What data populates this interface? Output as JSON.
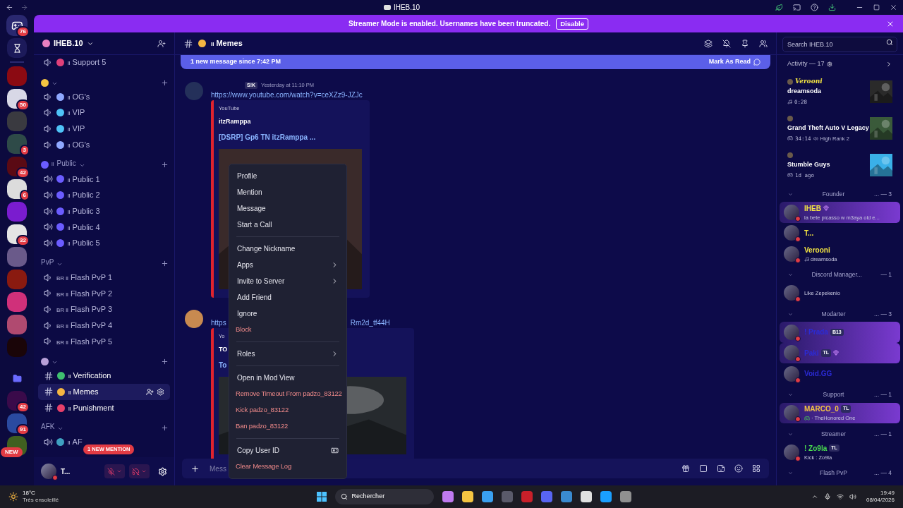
{
  "titlebar": {
    "title": "IHEB.10"
  },
  "banner": {
    "text": "Streamer Mode is enabled. Usernames have been truncated.",
    "button": "Disable"
  },
  "servers": [
    {
      "kind": "home",
      "badge": "76"
    },
    {
      "kind": "hourglass"
    },
    {
      "kind": "server",
      "color": "#8b0a12"
    },
    {
      "kind": "server",
      "color": "#d8d8e6",
      "badge": "50"
    },
    {
      "kind": "server",
      "color": "#3a3a40"
    },
    {
      "kind": "server",
      "color": "#2e4a48",
      "badge": "3"
    },
    {
      "kind": "server",
      "color": "#5a0a14",
      "badge": "42"
    },
    {
      "kind": "server",
      "color": "#dcdcdc",
      "badge": "6"
    },
    {
      "kind": "server",
      "color": "#7a1ccf"
    },
    {
      "kind": "server",
      "color": "#e4e4e4",
      "badge": "32"
    },
    {
      "kind": "server",
      "color": "#6a5a8a"
    },
    {
      "kind": "server",
      "color": "#8a1a10"
    },
    {
      "kind": "server",
      "color": "#d0307a"
    },
    {
      "kind": "server",
      "color": "#b04a70"
    },
    {
      "kind": "server",
      "color": "#1a0508"
    },
    {
      "kind": "folder"
    },
    {
      "kind": "server",
      "color": "#3a0a4a",
      "badge": "42"
    },
    {
      "kind": "server",
      "color": "#2a4aa0",
      "badge": "91"
    },
    {
      "kind": "server",
      "color": "#406020",
      "badge": "NEW"
    }
  ],
  "server_header": {
    "name": "IHEB.10"
  },
  "channels": [
    {
      "kind": "voice-locked",
      "color": "#e0407a",
      "prefix": "ll",
      "name": "Support 5",
      "selected": false
    },
    {
      "kind": "category",
      "color": "#f5c542"
    },
    {
      "kind": "voice-locked",
      "color": "#8fa8ff",
      "prefix": "ll",
      "name": "OG's",
      "selected": false
    },
    {
      "kind": "voice-locked",
      "color": "#4fc3f7",
      "prefix": "ll",
      "name": "VIP",
      "selected": false
    },
    {
      "kind": "voice-locked",
      "color": "#4fc3f7",
      "prefix": "ll",
      "name": "VIP",
      "selected": false
    },
    {
      "kind": "voice-locked",
      "color": "#8fa8ff",
      "prefix": "ll",
      "name": "OG's",
      "selected": false
    },
    {
      "kind": "category",
      "color": "#6b5cff",
      "prefix": "ll",
      "name": "Public"
    },
    {
      "kind": "voice",
      "color": "#6b5cff",
      "prefix": "ll",
      "name": "Public 1",
      "selected": false
    },
    {
      "kind": "voice",
      "color": "#6b5cff",
      "prefix": "ll",
      "name": "Public 2",
      "selected": false
    },
    {
      "kind": "voice",
      "color": "#6b5cff",
      "prefix": "ll",
      "name": "Public 3",
      "selected": false
    },
    {
      "kind": "voice",
      "color": "#6b5cff",
      "prefix": "ll",
      "name": "Public 4",
      "selected": false
    },
    {
      "kind": "voice",
      "color": "#6b5cff",
      "prefix": "ll",
      "name": "Public 5",
      "selected": false
    },
    {
      "kind": "category",
      "name": "PvP"
    },
    {
      "kind": "voice-locked",
      "prefix": "BR ll",
      "name": "Flash PvP 1",
      "selected": false
    },
    {
      "kind": "voice-locked",
      "prefix": "BR ll",
      "name": "Flash PvP 2",
      "selected": false
    },
    {
      "kind": "voice-locked",
      "prefix": "BR ll",
      "name": "Flash PvP 3",
      "selected": false
    },
    {
      "kind": "voice-locked",
      "prefix": "BR ll",
      "name": "Flash PvP 4",
      "selected": false
    },
    {
      "kind": "voice-locked",
      "prefix": "BR ll",
      "name": "Flash PvP 5",
      "selected": false
    },
    {
      "kind": "category",
      "color": "#b8a0d8"
    },
    {
      "kind": "text",
      "color": "#3fbf6f",
      "prefix": "ll",
      "name": "Verification",
      "selected": false
    },
    {
      "kind": "text",
      "color": "#f5b642",
      "prefix": "ll",
      "name": "Memes",
      "selected": true
    },
    {
      "kind": "text",
      "color": "#e8406a",
      "prefix": "ll",
      "name": "Punishment",
      "selected": false
    },
    {
      "kind": "category",
      "name": "AFK"
    },
    {
      "kind": "voice",
      "color": "#3fa0c0",
      "prefix": "ll",
      "name": "AF",
      "selected": false
    }
  ],
  "mention_pill": "1 NEW MENTION",
  "user_panel": {
    "name": "T..."
  },
  "chat_header": {
    "color": "#f5b642",
    "prefix": "ll",
    "name": "Memes"
  },
  "search": {
    "placeholder": "Search IHEB.10"
  },
  "new_messages": {
    "text": "1 new message since 7:42 PM",
    "action": "Mark As Read"
  },
  "messages": [
    {
      "tag": "S!K",
      "time": "Yesterday at 11:10 PM",
      "link": [
        "https://www.youtube.com/watch?v=ceXZz9-JZJc"
      ],
      "embed": {
        "provider": "YouTube",
        "author": "itzRamppa",
        "title": "[DSRP] Gp6 TN itzRamppa ..."
      }
    },
    {
      "link": [
        "https",
        "Rm2d_tf44H"
      ],
      "embed": {
        "provider": "Yo",
        "author": "TO",
        "title": "To"
      }
    }
  ],
  "input": {
    "placeholder": "Mess"
  },
  "context_menu": [
    {
      "kind": "item",
      "label": "Profile"
    },
    {
      "kind": "item",
      "label": "Mention"
    },
    {
      "kind": "item",
      "label": "Message"
    },
    {
      "kind": "item",
      "label": "Start a Call"
    },
    {
      "kind": "divider"
    },
    {
      "kind": "item",
      "label": "Change Nickname"
    },
    {
      "kind": "submenu",
      "label": "Apps"
    },
    {
      "kind": "submenu",
      "label": "Invite to Server"
    },
    {
      "kind": "item",
      "label": "Add Friend"
    },
    {
      "kind": "item",
      "label": "Ignore"
    },
    {
      "kind": "danger",
      "label": "Block"
    },
    {
      "kind": "divider"
    },
    {
      "kind": "submenu",
      "label": "Roles"
    },
    {
      "kind": "divider"
    },
    {
      "kind": "item",
      "label": "Open in Mod View"
    },
    {
      "kind": "danger",
      "label": "Remove Timeout From padzo_83122"
    },
    {
      "kind": "danger",
      "label": "Kick padzo_83122"
    },
    {
      "kind": "danger",
      "label": "Ban padzo_83122"
    },
    {
      "kind": "divider"
    },
    {
      "kind": "copy-id",
      "label": "Copy User ID"
    },
    {
      "kind": "danger",
      "label": "Clear Message Log"
    }
  ],
  "activity": {
    "title": "Activity — 17",
    "cards": [
      {
        "kind": "music",
        "user": "Verooni",
        "title": "dreamsoda",
        "detail": "0:28"
      },
      {
        "kind": "game",
        "title": "Grand Theft Auto V Legacy",
        "detail": "34:14",
        "extra": "High Rank 2"
      },
      {
        "kind": "game",
        "title": "Stumble Guys",
        "detail": "1d ago"
      }
    ]
  },
  "member_groups": [
    {
      "label": "Founder",
      "count": "... — 3",
      "members": [
        {
          "name": "IHEB",
          "color": "#f5e642",
          "booster": true,
          "highlighted": true,
          "status": "la bete picasso w m3aya old e..."
        },
        {
          "name": "T...",
          "color": "#f5e642",
          "booster": false,
          "highlighted": false
        },
        {
          "name": "Verooni",
          "color": "#f5e642",
          "booster": false,
          "highlighted": false,
          "status": "dreamsoda",
          "kind": "music"
        }
      ]
    },
    {
      "label": "Discord Manager...",
      "count": "— 1",
      "members": [
        {
          "booster": false,
          "highlighted": false,
          "status": "Like Zepekenio"
        }
      ]
    },
    {
      "label": "Modarter",
      "count": "... — 3",
      "members": [
        {
          "name": "! Prada",
          "color": "#2b2bd6",
          "tag": "B13",
          "booster": false,
          "highlighted": true
        },
        {
          "name": "Paki",
          "color": "#2b2bd6",
          "tag": "TL",
          "booster": true,
          "highlighted": true
        },
        {
          "name": "Void.GG",
          "color": "#2b2bd6",
          "booster": false,
          "highlighted": false
        }
      ]
    },
    {
      "label": "Support",
      "count": "... — 1",
      "members": [
        {
          "name": "MARCO_0",
          "color": "#f5c542",
          "tag": "TL",
          "booster": false,
          "highlighted": true,
          "status": "· TheHonored One",
          "kind": "game"
        }
      ]
    },
    {
      "label": "Streamer",
      "count": "... — 1",
      "members": [
        {
          "name": "! Zo9la",
          "color": "#4ade50",
          "tag": "TL",
          "booster": false,
          "highlighted": false,
          "status": "Kick : Zo9la"
        }
      ]
    },
    {
      "label": "Flash PvP",
      "count": "... — 4"
    }
  ],
  "taskbar": {
    "temperature": "18°C",
    "weather": "Très ensoleillé",
    "search": "Rechercher",
    "time": "19:49",
    "date": "08/04/2026"
  }
}
